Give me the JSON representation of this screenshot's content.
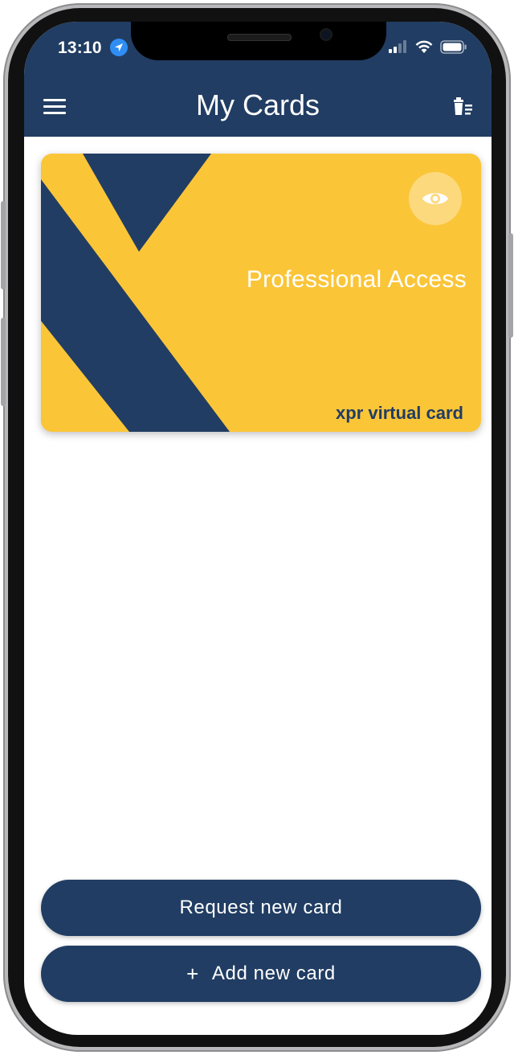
{
  "status_bar": {
    "time": "13:10",
    "icons": [
      "location-arrow-icon",
      "cellular-signal-icon",
      "wifi-icon",
      "battery-icon"
    ]
  },
  "header": {
    "title": "My Cards",
    "menu_icon": "hamburger-menu-icon",
    "delete_icon": "trash-list-icon"
  },
  "card": {
    "name": "Professional Access",
    "brand": "xpr virtual card",
    "view_icon": "eye-icon",
    "colors": {
      "background": "#fbc538",
      "shapes": "#213d63"
    }
  },
  "actions": {
    "request_label": "Request new card",
    "add_label": "Add new card",
    "add_icon": "plus-icon"
  },
  "colors": {
    "primary": "#213d63",
    "accent": "#fbc538",
    "location": "#2f8ef4"
  }
}
